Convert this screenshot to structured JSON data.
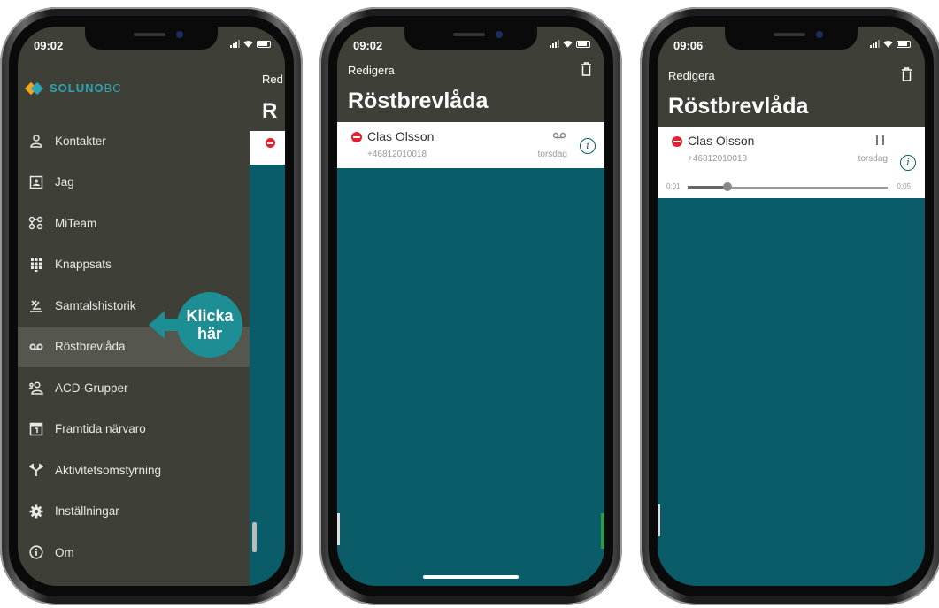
{
  "colors": {
    "header_bg": "#3e3f37",
    "teal_bg": "#0a5d68",
    "accent": "#1d8e93",
    "stop_red": "#e3202f",
    "logo": "#2aa6b4"
  },
  "phone1": {
    "time": "09:02",
    "logo_text": "SOLUNO",
    "logo_suffix": "BC",
    "behind_edit": "Red",
    "behind_title": "R",
    "menu": [
      {
        "label": "Kontakter",
        "icon": "contacts-icon"
      },
      {
        "label": "Jag",
        "icon": "profile-card-icon"
      },
      {
        "label": "MiTeam",
        "icon": "team-icon"
      },
      {
        "label": "Knappsats",
        "icon": "keypad-icon"
      },
      {
        "label": "Samtalshistorik",
        "icon": "call-history-icon"
      },
      {
        "label": "Röstbrevlåda",
        "icon": "voicemail-icon",
        "active": true
      },
      {
        "label": "ACD-Grupper",
        "icon": "acd-group-icon"
      },
      {
        "label": "Framtida närvaro",
        "icon": "calendar-icon"
      },
      {
        "label": "Aktivitetsomstyrning",
        "icon": "redirect-icon"
      },
      {
        "label": "Inställningar",
        "icon": "gear-icon"
      },
      {
        "label": "Om",
        "icon": "info-icon"
      }
    ],
    "callout_line1": "Klicka",
    "callout_line2": "här"
  },
  "phone2": {
    "time": "09:02",
    "edit_label": "Redigera",
    "title": "Röstbrevlåda",
    "item": {
      "name": "Clas Olsson",
      "number": "+46812010018",
      "day": "torsdag"
    }
  },
  "phone3": {
    "time": "09:06",
    "edit_label": "Redigera",
    "title": "Röstbrevlåda",
    "item": {
      "name": "Clas Olsson",
      "number": "+46812010018",
      "day": "torsdag"
    },
    "player": {
      "elapsed": "0:01",
      "total": "0:05",
      "progress": 0.2
    }
  }
}
